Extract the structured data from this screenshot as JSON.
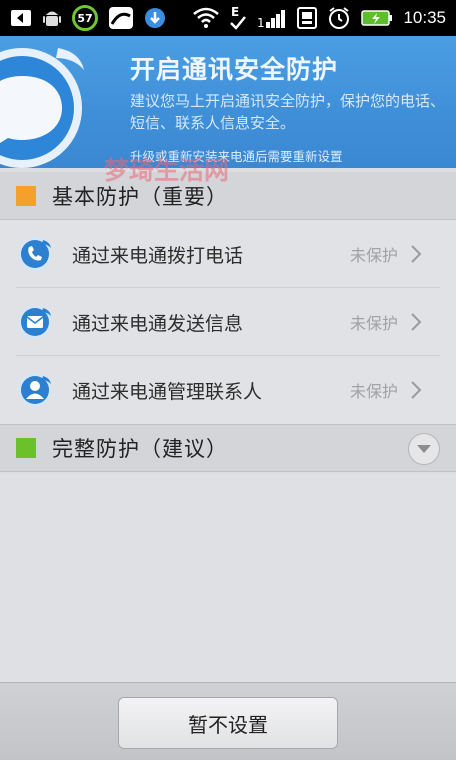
{
  "status_bar": {
    "time": "10:35",
    "badge": "57",
    "icons": [
      "back-icon",
      "android-debug-icon",
      "sync-badge-icon",
      "map-icon",
      "download-icon",
      "wifi-icon",
      "e-signal-icon",
      "check-icon",
      "cell-signal-icon",
      "storage-icon",
      "alarm-icon",
      "battery-charging-icon"
    ]
  },
  "header": {
    "title": "开启通讯安全防护",
    "description": "建议您马上开启通讯安全防护，保护您的电话、短信、联系人信息安全。",
    "note": "升级或重新安装来电通后需要重新设置"
  },
  "watermark": "梦琦生活网",
  "basic_section": {
    "title": "基本防护（重要）",
    "square_color": "#f5a02a",
    "items": [
      {
        "label": "通过来电通拨打电话",
        "status": "未保护",
        "icon": "phone-icon"
      },
      {
        "label": "通过来电通发送信息",
        "status": "未保护",
        "icon": "message-icon"
      },
      {
        "label": "通过来电通管理联系人",
        "status": "未保护",
        "icon": "contact-icon"
      }
    ]
  },
  "full_section": {
    "title": "完整防护（建议）",
    "square_color": "#6cc02a"
  },
  "footer": {
    "skip_label": "暂不设置"
  },
  "colors": {
    "header_blue": "#3f8fd8",
    "icon_blue": "#2d7fd0"
  }
}
